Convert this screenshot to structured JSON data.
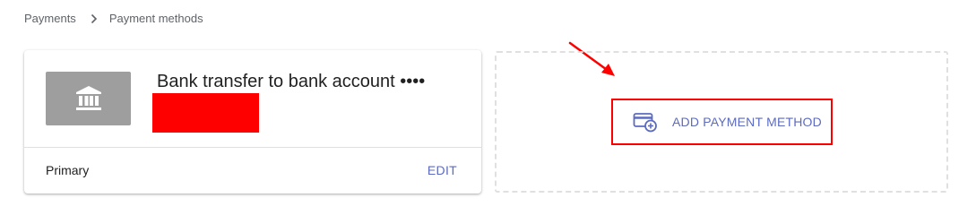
{
  "breadcrumb": {
    "items": [
      "Payments",
      "Payment methods"
    ],
    "separator_icon": "chevron-right-icon"
  },
  "payment_card": {
    "icon": "bank-icon",
    "icon_tile_color": "#9e9e9e",
    "title": "Bank transfer to bank account ••••",
    "footer_label": "Primary",
    "edit_label": "EDIT"
  },
  "add_method": {
    "icon": "add-card-icon",
    "label": "ADD PAYMENT METHOD"
  },
  "colors": {
    "accent": "#5c6bc0",
    "annotation": "#ff0000",
    "redaction": "#ff0000"
  }
}
